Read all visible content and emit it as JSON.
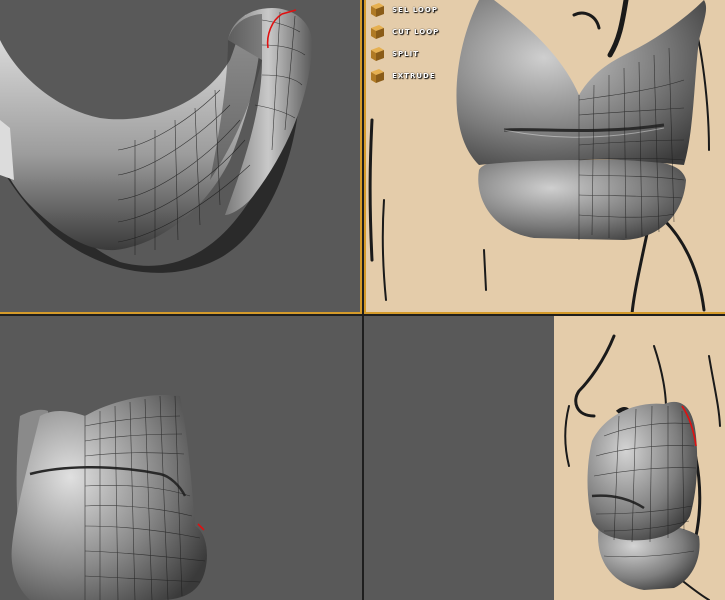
{
  "viewports": [
    {
      "id": "top",
      "active": true
    },
    {
      "id": "front",
      "active": true
    },
    {
      "id": "left",
      "active": false
    },
    {
      "id": "perspective",
      "active": false
    }
  ],
  "tools": [
    {
      "label": "SEL LOOP",
      "icon": "box-icon"
    },
    {
      "label": "CUT LOOP",
      "icon": "box-icon"
    },
    {
      "label": "SPLIT",
      "icon": "box-icon"
    },
    {
      "label": "EXTRUDE",
      "icon": "box-icon"
    }
  ],
  "colors": {
    "viewport_bg": "#595959",
    "reference_bg": "#e4ccaa",
    "active_border": "#d49a2a",
    "edge_highlight": "#e01010",
    "icon": "#c8922e"
  }
}
